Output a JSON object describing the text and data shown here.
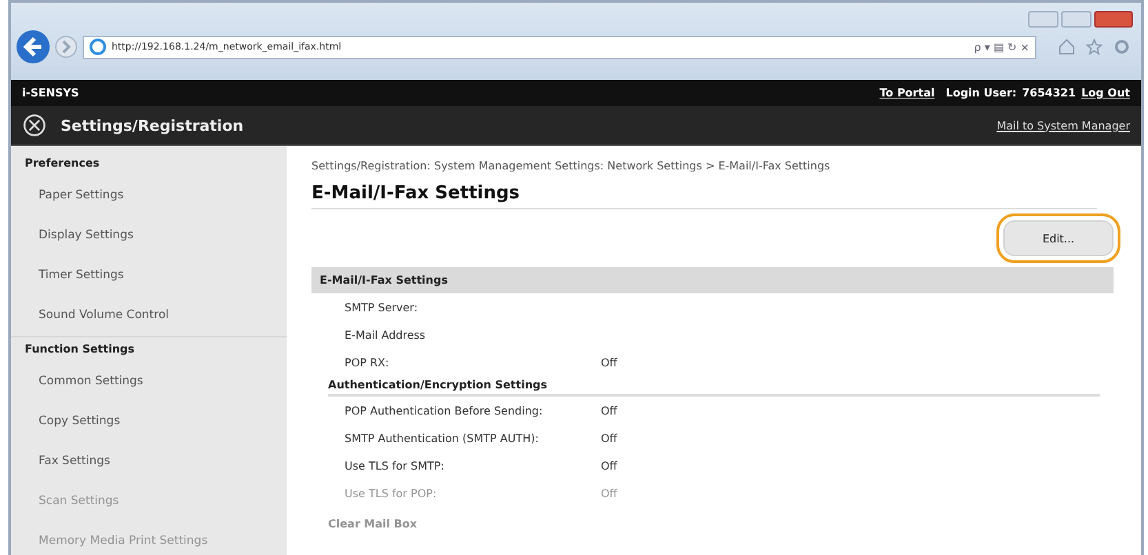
{
  "browser": {
    "url": "http://192.168.1.24/m_network_email_ifax.html",
    "toolbar_text": "ρ ▾ ▤ ↻ ×"
  },
  "header": {
    "brand": "i-SENSYS",
    "links": [
      {
        "text": "To Portal",
        "kind": "link"
      },
      {
        "text": "Login User:",
        "kind": "label"
      },
      {
        "text": "7654321",
        "kind": "label"
      },
      {
        "text": "Log Out",
        "kind": "link"
      }
    ]
  },
  "title_bar": {
    "title": "Settings/Registration",
    "link": "Mail to System Manager"
  },
  "sidebar": {
    "sections": [
      {
        "heading": "Preferences",
        "items": [
          {
            "label": "Paper Settings",
            "faded": false
          },
          {
            "label": "Display Settings",
            "faded": false
          },
          {
            "label": "Timer Settings",
            "faded": false
          },
          {
            "label": "Sound Volume Control",
            "faded": false
          }
        ]
      },
      {
        "heading": "Function Settings",
        "items": [
          {
            "label": "Common Settings",
            "faded": false
          },
          {
            "label": "Copy Settings",
            "faded": false
          },
          {
            "label": "Fax Settings",
            "faded": false
          },
          {
            "label": "Scan Settings",
            "faded": true
          },
          {
            "label": "Memory Media Print Settings",
            "faded": true
          }
        ]
      }
    ]
  },
  "breadcrumb": "Settings/Registration: System Management Settings: Network Settings > E-Mail/I-Fax Settings",
  "page_title": "E-Mail/I-Fax Settings",
  "edit_button": {
    "label": "Edit...",
    "highlighted": true
  },
  "panel": {
    "heading": "E-Mail/I-Fax Settings",
    "rows": [
      {
        "kind": "row",
        "label": "SMTP Server:",
        "value": "",
        "faded": false
      },
      {
        "kind": "row",
        "label": "E-Mail Address",
        "value": "",
        "faded": false
      },
      {
        "kind": "row",
        "label": "POP RX:",
        "value": "Off",
        "faded": false
      },
      {
        "kind": "subheading",
        "label": "Authentication/Encryption Settings",
        "faded": false
      },
      {
        "kind": "row",
        "label": "POP Authentication Before Sending:",
        "value": "Off",
        "faded": false
      },
      {
        "kind": "row",
        "label": "SMTP Authentication (SMTP AUTH):",
        "value": "Off",
        "faded": false
      },
      {
        "kind": "row",
        "label": "Use TLS for SMTP:",
        "value": "Off",
        "faded": false
      },
      {
        "kind": "row",
        "label": "Use TLS for POP:",
        "value": "Off",
        "faded": true
      },
      {
        "kind": "link",
        "label": "Clear Mail Box",
        "faded": true
      }
    ]
  }
}
